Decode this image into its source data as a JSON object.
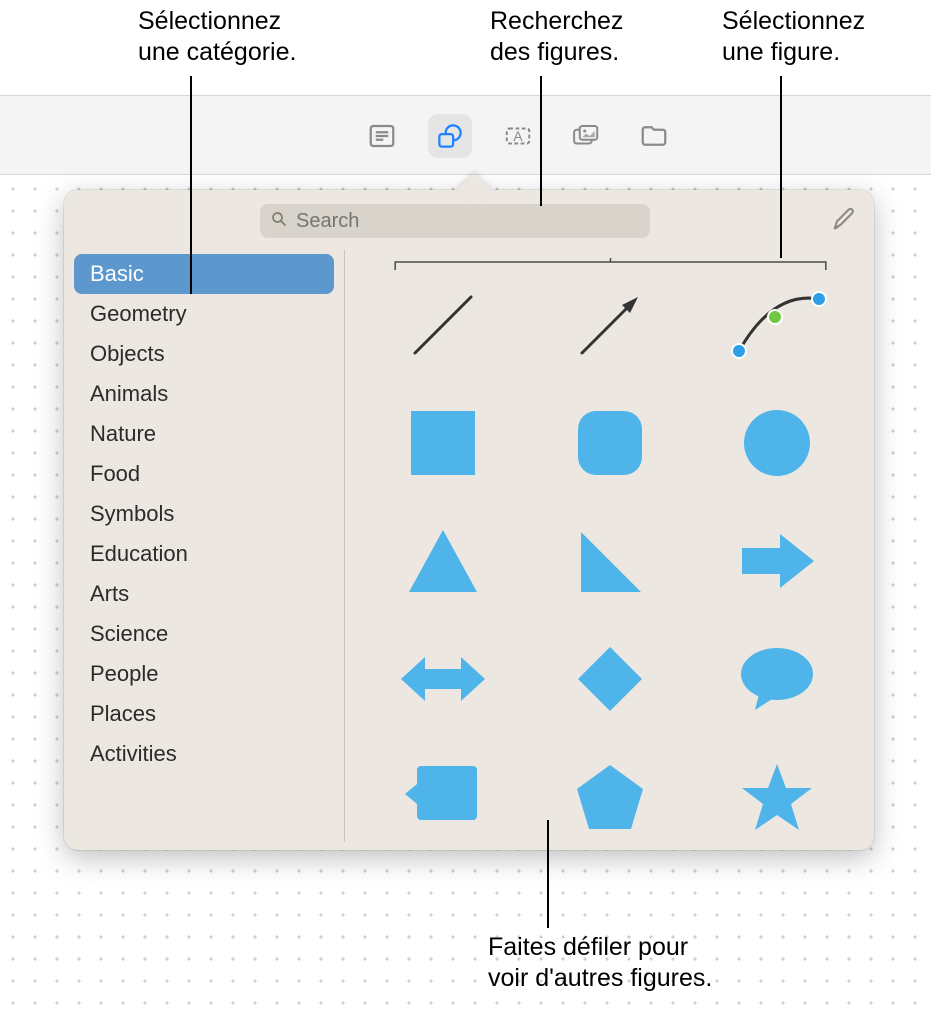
{
  "annotations": {
    "select_category": "Sélectionnez\nune catégorie.",
    "search_shapes": "Recherchez\ndes figures.",
    "select_shape": "Sélectionnez\nune figure.",
    "scroll_more": "Faites défiler pour\nvoir d'autres figures."
  },
  "toolbar": {
    "items": [
      {
        "name": "text-body-icon",
        "active": false
      },
      {
        "name": "shapes-icon",
        "active": true
      },
      {
        "name": "textbox-icon",
        "active": false
      },
      {
        "name": "media-icon",
        "active": false
      },
      {
        "name": "folder-icon",
        "active": false
      }
    ]
  },
  "search": {
    "placeholder": "Search",
    "value": ""
  },
  "categories": [
    {
      "label": "Basic",
      "selected": true
    },
    {
      "label": "Geometry",
      "selected": false
    },
    {
      "label": "Objects",
      "selected": false
    },
    {
      "label": "Animals",
      "selected": false
    },
    {
      "label": "Nature",
      "selected": false
    },
    {
      "label": "Food",
      "selected": false
    },
    {
      "label": "Symbols",
      "selected": false
    },
    {
      "label": "Education",
      "selected": false
    },
    {
      "label": "Arts",
      "selected": false
    },
    {
      "label": "Science",
      "selected": false
    },
    {
      "label": "People",
      "selected": false
    },
    {
      "label": "Places",
      "selected": false
    },
    {
      "label": "Activities",
      "selected": false
    }
  ],
  "shapes": [
    {
      "name": "line",
      "kind": "line"
    },
    {
      "name": "arrow-line",
      "kind": "arrow-line"
    },
    {
      "name": "curve",
      "kind": "curve"
    },
    {
      "name": "square",
      "kind": "square"
    },
    {
      "name": "rounded-square",
      "kind": "rounded-square"
    },
    {
      "name": "circle",
      "kind": "circle"
    },
    {
      "name": "triangle",
      "kind": "triangle"
    },
    {
      "name": "right-triangle",
      "kind": "right-triangle"
    },
    {
      "name": "arrow-right",
      "kind": "arrow-right"
    },
    {
      "name": "double-arrow",
      "kind": "double-arrow"
    },
    {
      "name": "diamond",
      "kind": "diamond"
    },
    {
      "name": "speech-bubble",
      "kind": "speech-bubble"
    },
    {
      "name": "callout-square",
      "kind": "callout-square"
    },
    {
      "name": "pentagon",
      "kind": "pentagon"
    },
    {
      "name": "star",
      "kind": "star"
    }
  ],
  "colors": {
    "shape_fill": "#4fb4e9",
    "selection": "#5c97cd",
    "handle_blue": "#2e9fe8",
    "handle_green": "#6ec841"
  }
}
